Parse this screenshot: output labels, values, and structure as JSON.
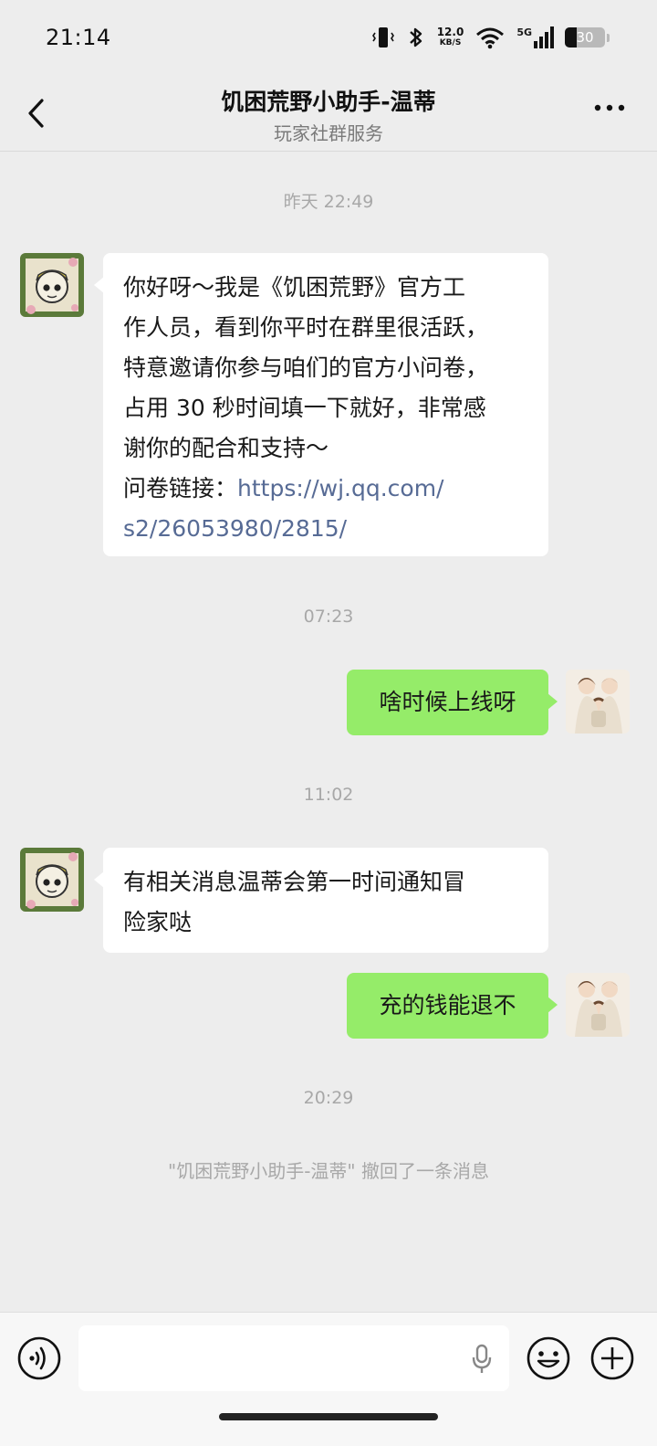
{
  "status_bar": {
    "time": "21:14",
    "net_speed": "12.0",
    "net_unit": "KB/S",
    "network": "5G",
    "battery": "30",
    "battery_level": 0.3
  },
  "header": {
    "title": "饥困荒野小助手-温蒂",
    "subtitle": "玩家社群服务"
  },
  "messages": [
    {
      "type": "timestamp",
      "text": "昨天 22:49"
    },
    {
      "type": "incoming",
      "lines": [
        "你好呀～我是《饥困荒野》官方工",
        "作人员，看到你平时在群里很活跃，",
        "特意邀请你参与咱们的官方小问卷，",
        "占用 30 秒时间填一下就好，非常感",
        "谢你的配合和支持～"
      ],
      "link_prefix": "问卷链接：",
      "link_part1": "https://wj.qq.com/",
      "link_part2": "s2/26053980/2815/"
    },
    {
      "type": "timestamp",
      "text": "07:23"
    },
    {
      "type": "outgoing",
      "text": "啥时候上线呀"
    },
    {
      "type": "timestamp",
      "text": "11:02"
    },
    {
      "type": "incoming",
      "lines": [
        "有相关消息温蒂会第一时间通知冒",
        "险家哒"
      ]
    },
    {
      "type": "outgoing",
      "text": "充的钱能退不"
    },
    {
      "type": "timestamp",
      "text": "20:29"
    },
    {
      "type": "system",
      "text": "\"饥困荒野小助手-温蒂\" 撤回了一条消息"
    }
  ],
  "input_bar": {
    "placeholder": ""
  },
  "icons": {
    "back": "back-chevron-icon",
    "more": "more-dots-icon",
    "voice": "voice-icon",
    "mic": "microphone-icon",
    "emoji": "emoji-icon",
    "plus": "plus-icon"
  },
  "colors": {
    "background": "#ededed",
    "outgoing_bubble": "#95ec69",
    "incoming_bubble": "#ffffff",
    "link": "#576b95"
  }
}
